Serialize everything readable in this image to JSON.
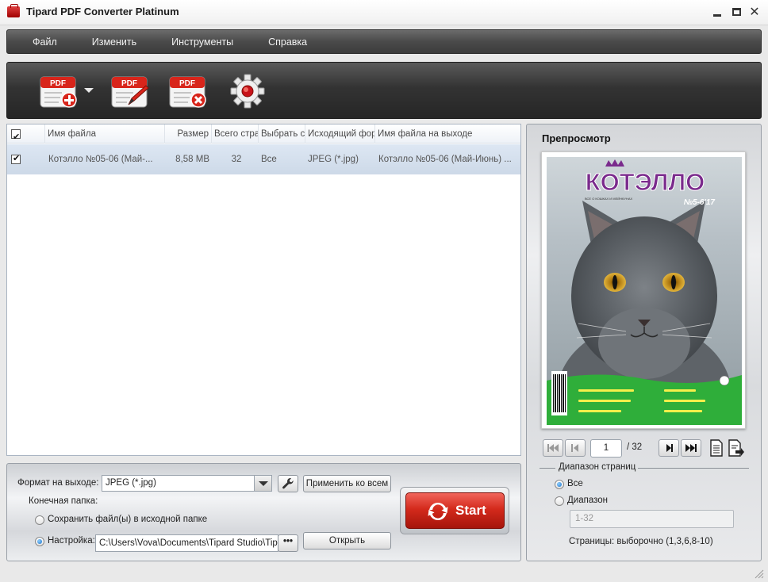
{
  "window": {
    "title": "Tipard PDF Converter Platinum"
  },
  "menu": {
    "items": [
      "Файл",
      "Изменить",
      "Инструменты",
      "Справка"
    ]
  },
  "toolbar": {
    "add_pdf_label": "PDF",
    "edit_pdf_label": "PDF",
    "remove_pdf_label": "PDF"
  },
  "file_list": {
    "columns": [
      "Имя файла",
      "Размер",
      "Всего стран",
      "Выбрать ст",
      "Исходящий форм",
      "Имя файла на выходе"
    ],
    "rows": [
      {
        "checked": true,
        "name": "Котэлло №05-06 (Май-...",
        "size": "8,58 MB",
        "total_pages": "32",
        "selected_pages": "Все",
        "output_format": "JPEG (*.jpg)",
        "output_name": "Котэлло №05-06 (Май-Июнь) ..."
      }
    ]
  },
  "bottom": {
    "format_label": "Формат на выходе:",
    "format_value": "JPEG (*.jpg)",
    "apply_all_label": "Применить ко всем",
    "dest_folder_label": "Конечная папка:",
    "save_source_label": "Сохранить файл(ы) в исходной папке",
    "custom_label": "Настройка:",
    "path_value": "C:\\Users\\Vova\\Documents\\Tipard Studio\\Tipard",
    "browse_label": "•••",
    "open_label": "Открыть",
    "start_label": "Start"
  },
  "preview": {
    "title": "Препросмотр",
    "cover": {
      "brand": "КОТЭЛЛО",
      "issue": "№5-6'17",
      "tagline": "ВСЕ О КОШКАХ И МЕЙНКУНАХ"
    },
    "page_current": "1",
    "page_total": "/ 32",
    "range_title": "Диапазон страниц",
    "all_label": "Все",
    "range_label": "Диапазон",
    "range_placeholder": "1-32",
    "pages_note": "Страницы: выборочно (1,3,6,8-10)"
  },
  "colors": {
    "accent_red": "#d42a1c",
    "menubar": "#4a4a4a",
    "row_selected": "#d3deeb"
  }
}
